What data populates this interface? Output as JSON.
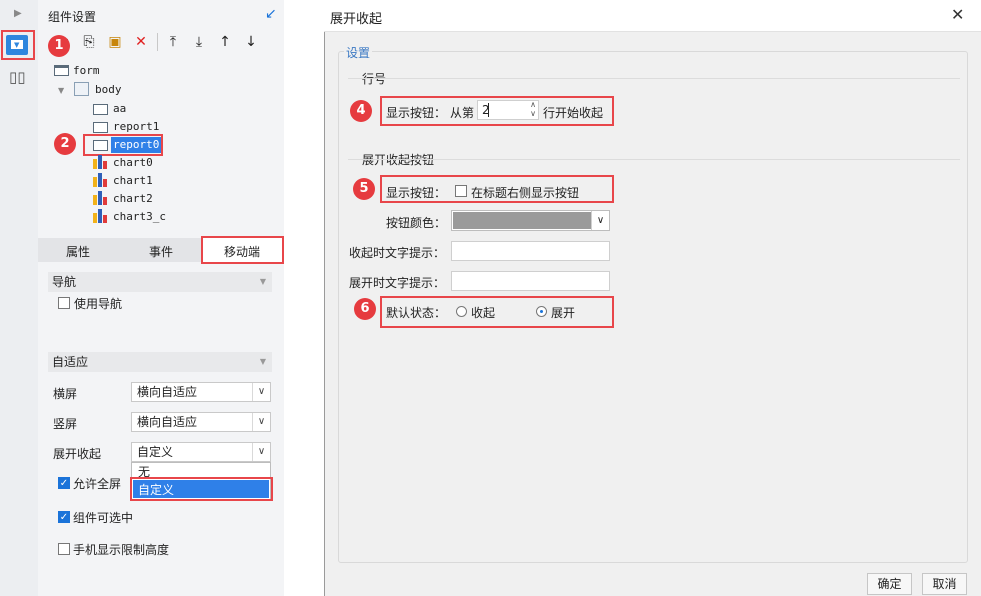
{
  "left_panel": {
    "header_title": "组件设置",
    "tree": {
      "root": "form",
      "body": "body",
      "children": [
        "aa",
        "report1",
        "report0"
      ],
      "charts": [
        "chart0",
        "chart1",
        "chart2",
        "chart3_c"
      ]
    },
    "tabs": [
      "属性",
      "事件",
      "移动端"
    ],
    "nav_section": "导航",
    "use_nav_label": "使用导航",
    "adaptive_section": "自适应",
    "rows": [
      {
        "label": "横屏",
        "value": "横向自适应"
      },
      {
        "label": "竖屏",
        "value": "横向自适应"
      },
      {
        "label": "展开收起",
        "value": "自定义"
      }
    ],
    "dropdown_options": [
      "无",
      "自定义"
    ],
    "allow_fullscreen_label": "允许全屏",
    "component_selectable_label": "组件可选中",
    "phone_limit_height_label": "手机显示限制高度"
  },
  "dialog": {
    "title": "展开收起",
    "settings_group": "设置",
    "row_number_section": "行号",
    "show_button_label": "显示按钮：",
    "from_row_label": "从第",
    "from_row_value": "2",
    "start_collapse_label": "行开始收起",
    "expand_collapse_section": "展开收起按钮",
    "show_button_label2": "显示按钮：",
    "show_right_of_title_label": "在标题右侧显示按钮",
    "button_color_label": "按钮颜色：",
    "button_color": "#9a9a9a",
    "collapsed_hint_label": "收起时文字提示：",
    "expanded_hint_label": "展开时文字提示：",
    "default_state_label": "默认状态：",
    "state_collapse": "收起",
    "state_expand": "展开",
    "ok_label": "确定",
    "cancel_label": "取消"
  },
  "badges": [
    "1",
    "2",
    "3",
    "4",
    "5",
    "6"
  ],
  "colors": {
    "accent": "#1a73d9",
    "highlight": "#e8464a",
    "selection": "#2f80e8"
  }
}
